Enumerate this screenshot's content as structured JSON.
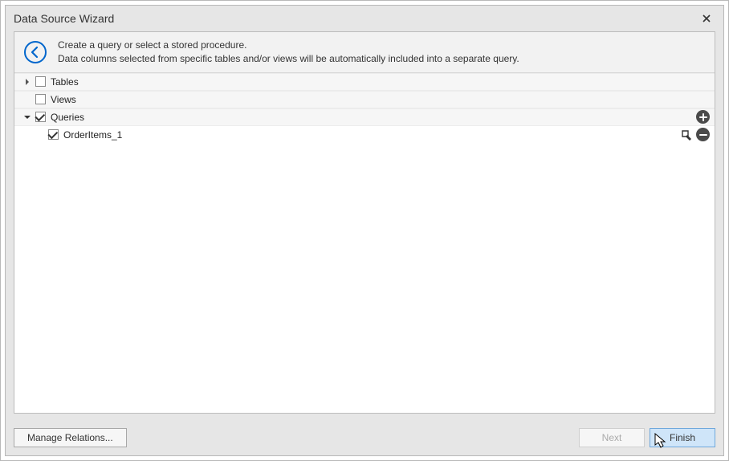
{
  "title": "Data Source Wizard",
  "hint": {
    "line1": "Create a query or select a stored procedure.",
    "line2": "Data columns selected from specific tables and/or views will be automatically included into a separate query."
  },
  "tree": {
    "tables": {
      "label": "Tables",
      "expanded": false,
      "checked": false
    },
    "views": {
      "label": "Views",
      "expanded": false,
      "checked": false
    },
    "queries": {
      "label": "Queries",
      "expanded": true,
      "checked": true,
      "items": [
        {
          "label": "OrderItems_1",
          "checked": true
        }
      ]
    }
  },
  "buttons": {
    "manage": "Manage Relations...",
    "next": "Next",
    "finish": "Finish"
  },
  "icons": {
    "add": "add-icon",
    "remove": "remove-icon",
    "edit": "edit-query-icon",
    "back": "back-icon",
    "close": "close-icon"
  }
}
